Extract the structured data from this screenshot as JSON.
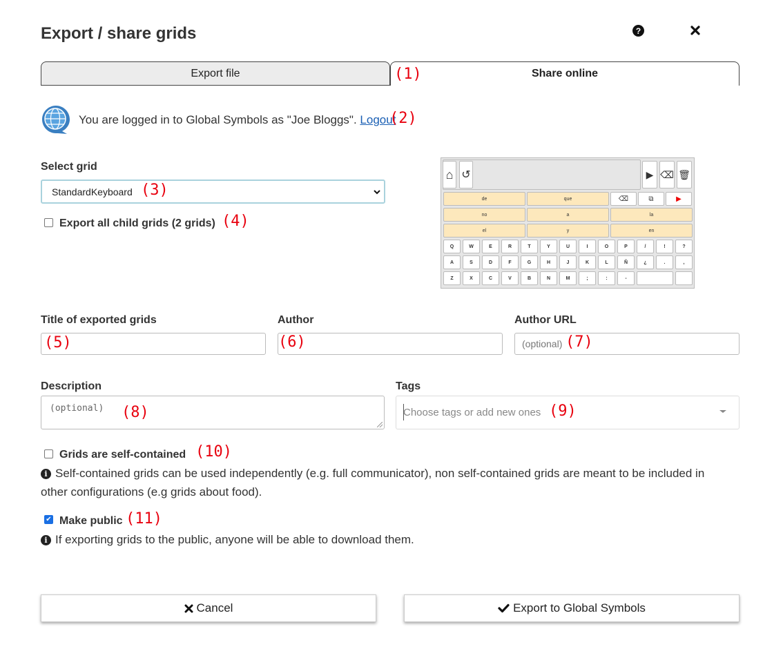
{
  "dialog": {
    "title": "Export / share grids",
    "help_icon": "question-circle-icon",
    "close_icon": "close-x-icon"
  },
  "tabs": [
    {
      "label": "Export file",
      "active": false
    },
    {
      "label": "Share online",
      "active": true
    }
  ],
  "login": {
    "text": "You are logged in to Global Symbols as \"Joe Bloggs\".",
    "logout_label": "Logout",
    "logo_icon": "global-symbols-logo-icon"
  },
  "select_grid": {
    "label": "Select grid",
    "value": "StandardKeyboard"
  },
  "export_children": {
    "label": "Export all child grids (2 grids)",
    "checked": false
  },
  "preview": {
    "word_rows": [
      [
        "de",
        "que",
        ""
      ],
      [
        "no",
        "a",
        "la"
      ],
      [
        "el",
        "y",
        "en"
      ]
    ],
    "key_rows": [
      [
        "Q",
        "W",
        "E",
        "R",
        "T",
        "Y",
        "U",
        "I",
        "O",
        "P",
        "/",
        "!",
        "?"
      ],
      [
        "A",
        "S",
        "D",
        "F",
        "G",
        "H",
        "J",
        "K",
        "L",
        "Ñ",
        "¿",
        ".",
        ","
      ],
      [
        "Z",
        "X",
        "C",
        "V",
        "B",
        "N",
        "M",
        ";",
        ":",
        "-",
        "",
        "",
        ""
      ]
    ]
  },
  "fields": {
    "title": {
      "label": "Title of exported grids",
      "value": ""
    },
    "author": {
      "label": "Author",
      "value": ""
    },
    "author_url": {
      "label": "Author URL",
      "placeholder": "(optional)"
    },
    "description": {
      "label": "Description",
      "placeholder": "(optional)"
    },
    "tags": {
      "label": "Tags",
      "placeholder": "Choose tags or add new ones"
    }
  },
  "self_contained": {
    "label": "Grids are self-contained",
    "checked": false,
    "info": "Self-contained grids can be used independently (e.g. full communicator), non self-contained grids are meant to be included in other configurations (e.g grids about food)."
  },
  "make_public": {
    "label": "Make public",
    "checked": true,
    "info": "If exporting grids to the public, anyone will be able to download them."
  },
  "buttons": {
    "cancel": "Cancel",
    "export": "Export to Global Symbols"
  },
  "annotations": {
    "a1": "(1)",
    "a2": "(2)",
    "a3": "(3)",
    "a4": "(4)",
    "a5": "(5)",
    "a6": "(6)",
    "a7": "(7)",
    "a8": "(8)",
    "a9": "(9)",
    "a10": "(10)",
    "a11": "(11)"
  },
  "colors": {
    "annotation": "#e8000e",
    "link": "#1a5fb4",
    "preview_word_cell": "#fde8bc"
  }
}
